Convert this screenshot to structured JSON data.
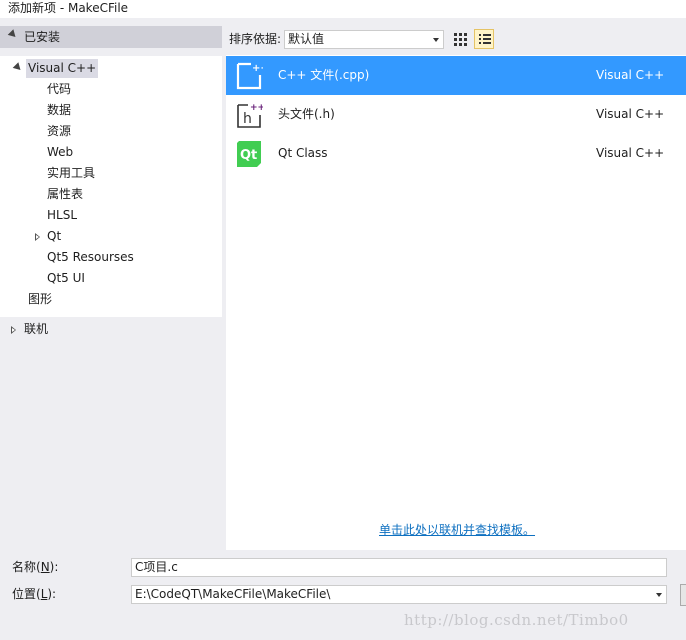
{
  "window": {
    "title": "添加新项 - MakeCFile"
  },
  "left_panel": {
    "installed_label": "已安装",
    "tree": [
      {
        "label": "Visual C++",
        "level": 0,
        "state": "expanded",
        "selected": true
      },
      {
        "label": "代码",
        "level": 1
      },
      {
        "label": "数据",
        "level": 1
      },
      {
        "label": "资源",
        "level": 1
      },
      {
        "label": "Web",
        "level": 1
      },
      {
        "label": "实用工具",
        "level": 1
      },
      {
        "label": "属性表",
        "level": 1
      },
      {
        "label": "HLSL",
        "level": 1
      },
      {
        "label": "Qt",
        "level": 1,
        "state": "collapsed"
      },
      {
        "label": "Qt5 Resourses",
        "level": 1
      },
      {
        "label": "Qt5 UI",
        "level": 1
      },
      {
        "label": "图形",
        "level": 0
      }
    ],
    "online_label": "联机"
  },
  "toolbar": {
    "sort_label": "排序依据:",
    "sort_value": "默认值"
  },
  "templates": [
    {
      "name": "C++ 文件(.cpp)",
      "lang": "Visual C++",
      "icon": "cpp-file-icon",
      "selected": true
    },
    {
      "name": "头文件(.h)",
      "lang": "Visual C++",
      "icon": "header-file-icon",
      "selected": false
    },
    {
      "name": "Qt Class",
      "lang": "Visual C++",
      "icon": "qt-class-icon",
      "selected": false
    }
  ],
  "online_link": "单击此处以联机并查找模板。",
  "form": {
    "name_label": "名称(",
    "name_key": "N",
    "name_label_end": "):",
    "name_value": "C项目.c",
    "location_label": "位置(",
    "location_key": "L",
    "location_label_end": "):",
    "location_value": "E:\\CodeQT\\MakeCFile\\MakeCFile\\"
  },
  "watermark": "http://blog.csdn.net/Timbo0",
  "colors": {
    "selection": "#3399ff",
    "link": "#0e70c0",
    "panel_bg": "#eeeef2",
    "qt_green": "#41cd52"
  }
}
